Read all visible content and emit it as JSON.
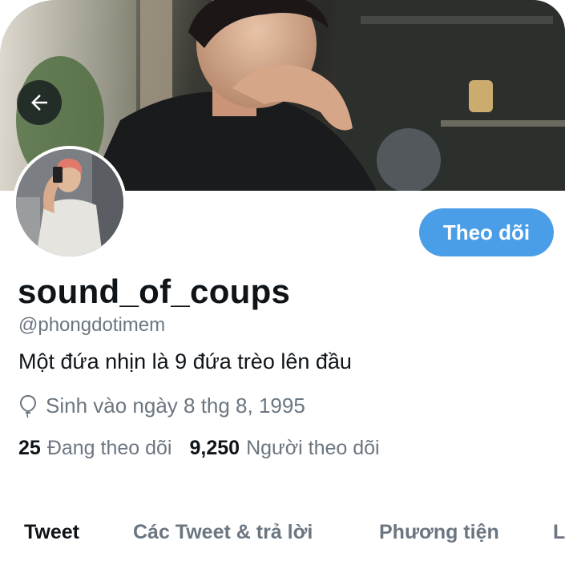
{
  "header": {
    "back_button": {
      "icon": "arrow-left-icon"
    }
  },
  "profile": {
    "display_name": "sound_of_coups",
    "handle": "@phongdotimem",
    "bio": "Một đứa nhịn là 9 đứa trèo lên đầu",
    "birth_icon": "balloon-icon",
    "birth_text": "Sinh vào ngày 8 thg 8, 1995",
    "follow_label": "Theo dõi"
  },
  "stats": {
    "following_count": "25",
    "following_label": "Đang theo dõi",
    "followers_count": "9,250",
    "followers_label": "Người theo dõi"
  },
  "tabs": [
    {
      "label": "Tweet",
      "active": true
    },
    {
      "label": "Các Tweet & trả lời",
      "active": false
    },
    {
      "label": "Phương tiện",
      "active": false
    },
    {
      "label": "L",
      "active": false
    }
  ],
  "colors": {
    "accent": "#4a9ee8",
    "text_primary": "#0f1419",
    "text_secondary": "#6b7680"
  }
}
